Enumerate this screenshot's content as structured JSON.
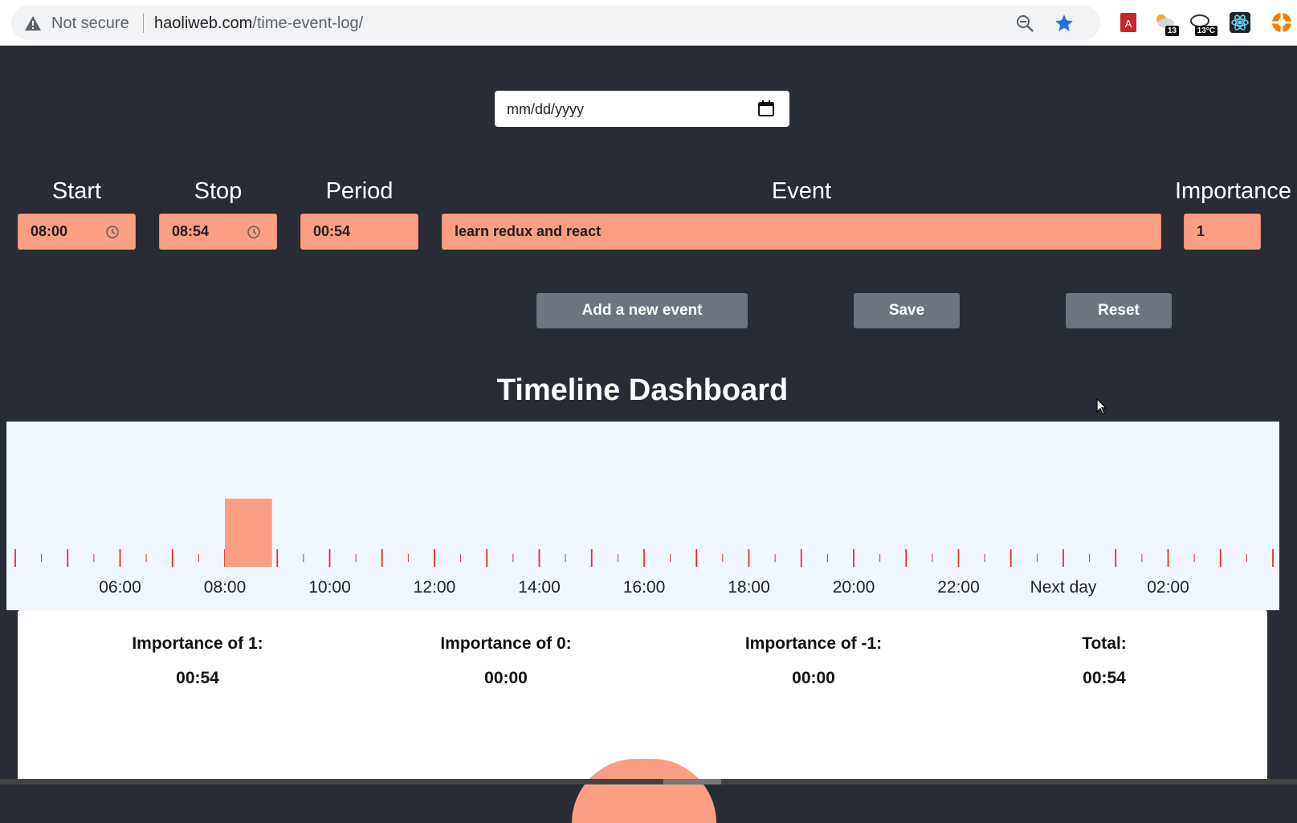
{
  "browser": {
    "security_label": "Not secure",
    "url_domain": "haoliweb.com",
    "url_path": "/time-event-log/",
    "weather_badge_1": "13",
    "weather_badge_2": "13°C"
  },
  "form": {
    "date_placeholder": "mm/dd/yyyy",
    "labels": {
      "start": "Start",
      "stop": "Stop",
      "period": "Period",
      "event": "Event",
      "importance": "Importance"
    },
    "values": {
      "start": "08:00",
      "stop": "08:54",
      "period": "00:54",
      "event": "learn redux and react",
      "importance": "1"
    }
  },
  "buttons": {
    "add": "Add a new event",
    "save": "Save",
    "reset": "Reset"
  },
  "dashboard": {
    "title": "Timeline Dashboard",
    "tick_labels": [
      "06:00",
      "08:00",
      "10:00",
      "12:00",
      "14:00",
      "16:00",
      "18:00",
      "20:00",
      "22:00",
      "Next day",
      "02:00"
    ]
  },
  "chart_data": {
    "type": "bar",
    "x_axis": "time of day",
    "tick_labels": [
      "06:00",
      "08:00",
      "10:00",
      "12:00",
      "14:00",
      "16:00",
      "18:00",
      "20:00",
      "22:00",
      "Next day",
      "02:00"
    ],
    "events": [
      {
        "start": "08:00",
        "stop": "08:54",
        "importance": 1
      }
    ],
    "colors": {
      "bar": "#fa9f84",
      "ticks": "#e03030"
    }
  },
  "summary": [
    {
      "label": "Importance of 1:",
      "value": "00:54"
    },
    {
      "label": "Importance of 0:",
      "value": "00:00"
    },
    {
      "label": "Importance of -1:",
      "value": "00:00"
    },
    {
      "label": "Total:",
      "value": "00:54"
    }
  ],
  "colors": {
    "background": "#282c34",
    "field": "#fa9f84",
    "button": "#6c757d",
    "timeline_bg": "#f0f7ff"
  }
}
